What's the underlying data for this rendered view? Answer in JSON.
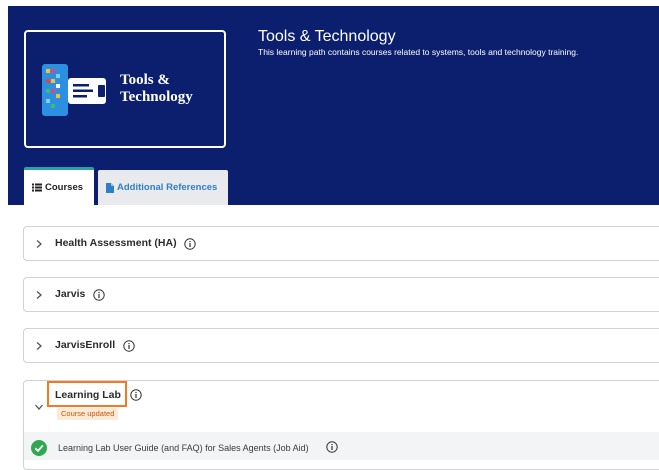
{
  "banner": {
    "logo_line1": "Tools &",
    "logo_line2": "Technology",
    "title": "Tools & Technology",
    "description": "This learning path contains courses related to systems, tools and technology training."
  },
  "tabs": [
    {
      "label": "Courses",
      "icon": "list-icon",
      "active": true
    },
    {
      "label": "Additional References",
      "icon": "document-icon",
      "active": false
    }
  ],
  "accordions": [
    {
      "title": "Health Assessment (HA)",
      "expanded": false
    },
    {
      "title": "Jarvis",
      "expanded": false
    },
    {
      "title": "JarvisEnroll",
      "expanded": false
    },
    {
      "title": "Learning Lab",
      "expanded": true,
      "badge": "Course updated",
      "items": [
        {
          "label": "Learning Lab User Guide (and FAQ) for Sales Agents (Job Aid)",
          "status": "completed"
        }
      ]
    }
  ],
  "colors": {
    "banner_bg": "#0b1f6e",
    "tab_accent": "#2aa0a8",
    "link_blue": "#2f7fc6",
    "highlight_orange": "#f07b22",
    "success_green": "#2fa84f"
  }
}
